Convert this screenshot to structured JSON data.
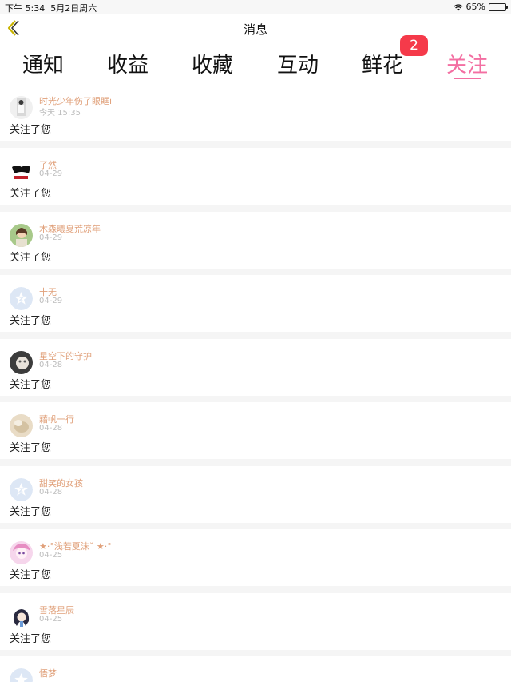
{
  "status_bar": {
    "time": "下午 5:34",
    "date": "5月2日周六",
    "battery": "65%",
    "battery_level": 0.65
  },
  "nav": {
    "title": "消息",
    "back_icon": "chevron-left-icon"
  },
  "tabs": [
    {
      "label": "通知"
    },
    {
      "label": "收益"
    },
    {
      "label": "收藏"
    },
    {
      "label": "互动"
    },
    {
      "label": "鲜花",
      "badge": "2"
    },
    {
      "label": "关注",
      "active": true
    }
  ],
  "colors": {
    "accent": "#f36fa2",
    "badge": "#f53a4a",
    "username": "#e0a07a",
    "timestamp": "#bdbdbd"
  },
  "feed": [
    {
      "username": "时光少年伤了眼眶i",
      "time": "今天 15:35",
      "action": "关注了您",
      "avatar": "photo-avatar"
    },
    {
      "username": "了然",
      "time": "04-29",
      "action": "关注了您",
      "avatar": "logo-avatar"
    },
    {
      "username": "木森曦夏荒凉年",
      "time": "04-29",
      "action": "关注了您",
      "avatar": "photo-avatar"
    },
    {
      "username": "十无",
      "time": "04-29",
      "action": "关注了您",
      "avatar": "default-star-avatar"
    },
    {
      "username": "星空下的守护",
      "time": "04-28",
      "action": "关注了您",
      "avatar": "photo-avatar"
    },
    {
      "username": "藉帆一行",
      "time": "04-28",
      "action": "关注了您",
      "avatar": "photo-avatar"
    },
    {
      "username": "甜笑的女孩",
      "time": "04-28",
      "action": "关注了您",
      "avatar": "default-star-avatar"
    },
    {
      "username": "★·°浅若夏沫ˇ ★·°",
      "time": "04-25",
      "action": "关注了您",
      "avatar": "photo-avatar"
    },
    {
      "username": "雪落星辰",
      "time": "04-25",
      "action": "关注了您",
      "avatar": "photo-avatar"
    },
    {
      "username": "悟梦",
      "time": "",
      "action": "",
      "avatar": "default-star-avatar"
    }
  ]
}
